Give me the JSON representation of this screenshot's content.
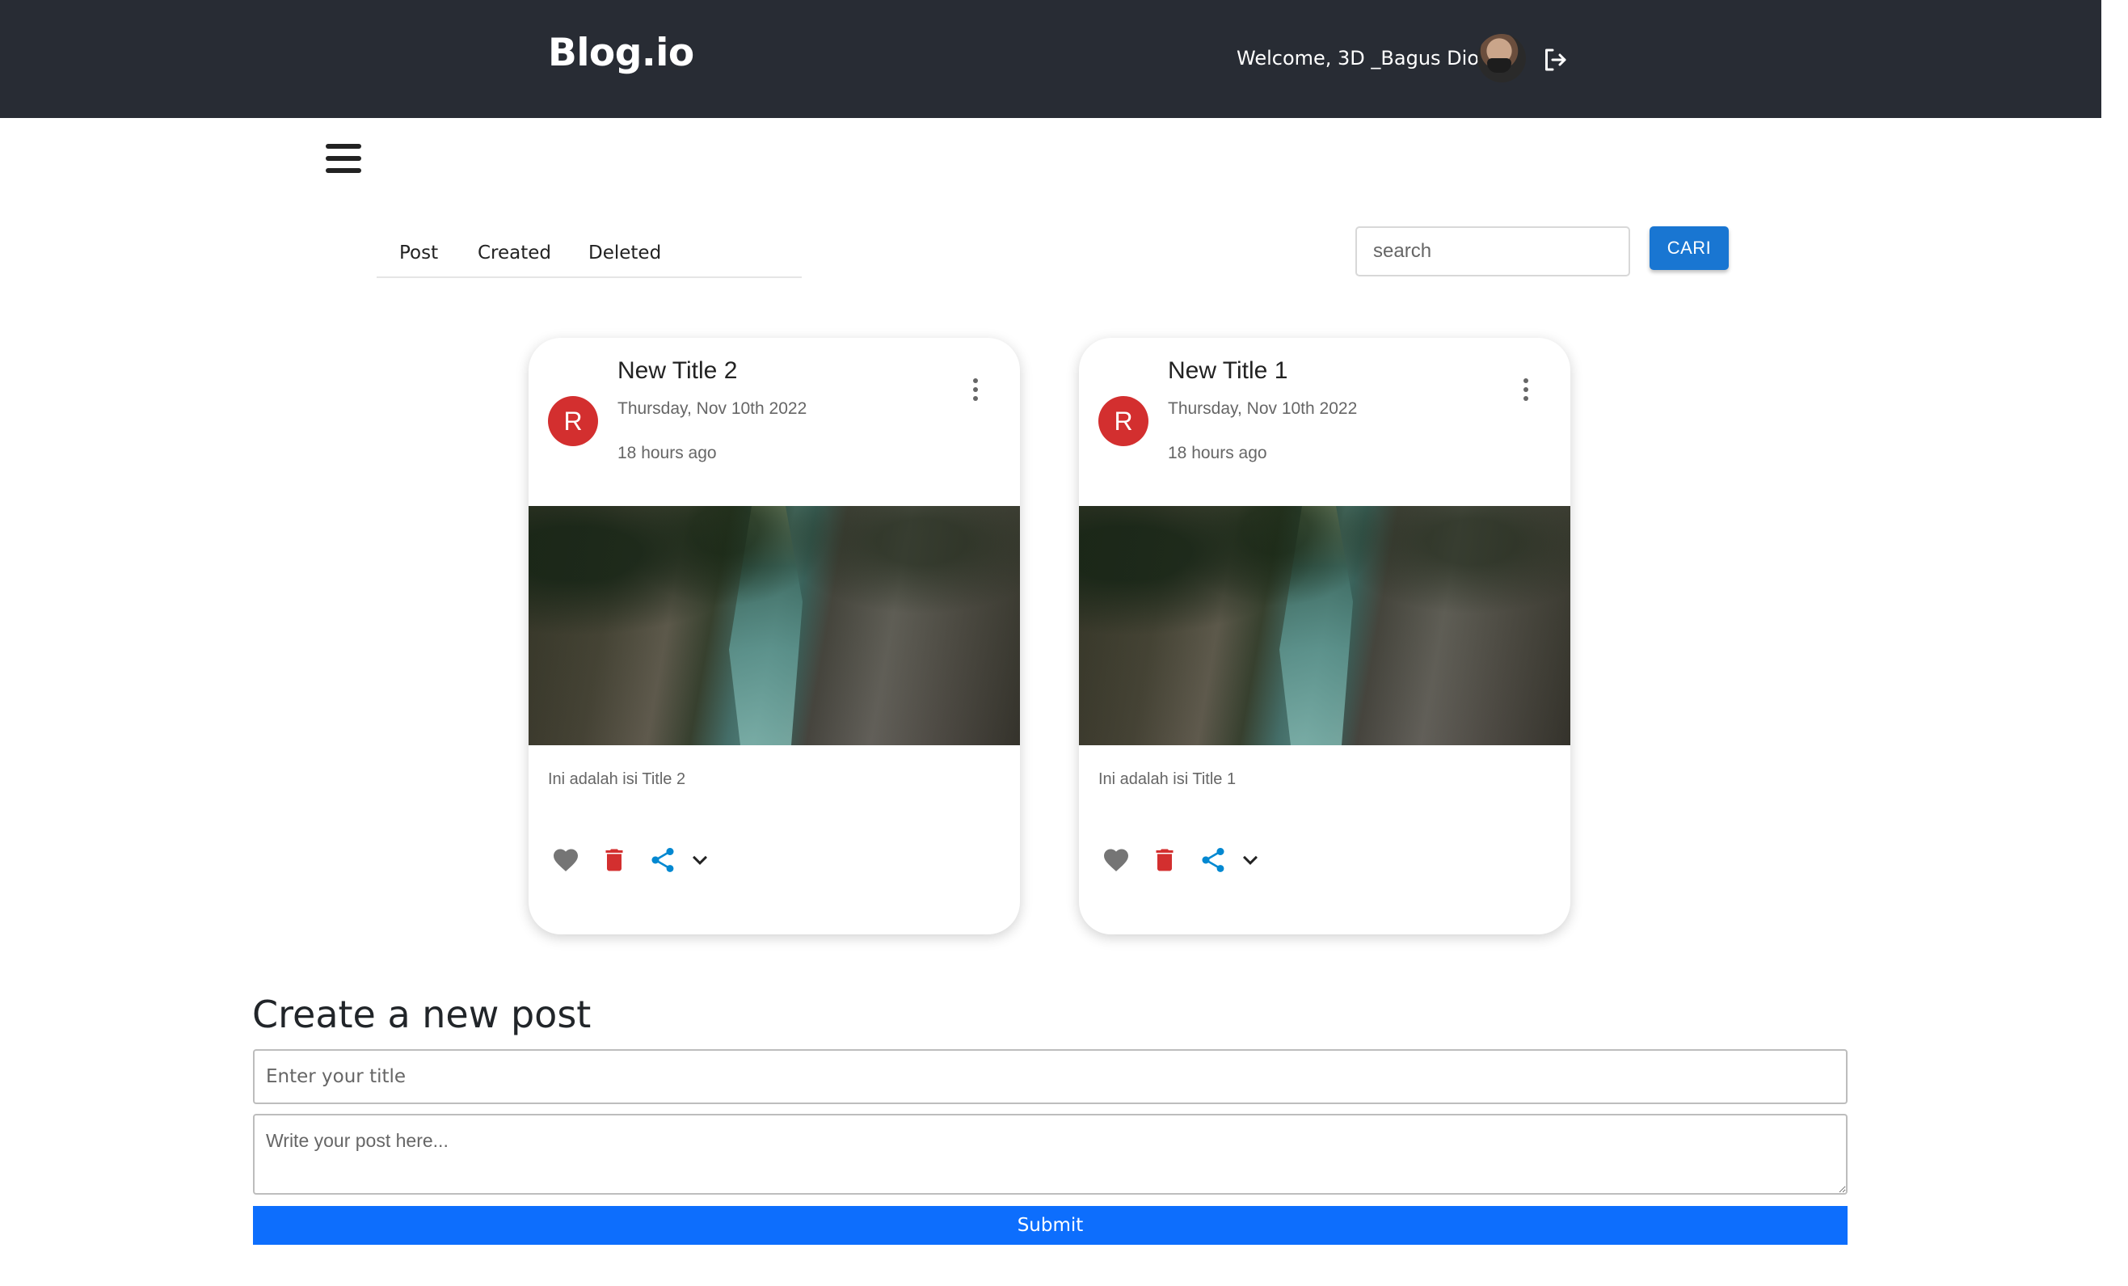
{
  "header": {
    "brand": "Blog.io",
    "welcome": "Welcome, 3D _Bagus Dio!"
  },
  "tabs": [
    {
      "label": "Post"
    },
    {
      "label": "Created"
    },
    {
      "label": "Deleted"
    }
  ],
  "search": {
    "placeholder": "search",
    "button_label": "CARI"
  },
  "posts": [
    {
      "avatar_letter": "R",
      "title": "New Title 2",
      "date": "Thursday, Nov 10th 2022",
      "relative_time": "18 hours ago",
      "body": "Ini adalah isi Title 2"
    },
    {
      "avatar_letter": "R",
      "title": "New Title 1",
      "date": "Thursday, Nov 10th 2022",
      "relative_time": "18 hours ago",
      "body": "Ini adalah isi Title 1"
    }
  ],
  "create_post": {
    "heading": "Create a new post",
    "title_placeholder": "Enter your title",
    "content_placeholder": "Write your post here...",
    "submit_label": "Submit"
  },
  "colors": {
    "header_bg": "#282c34",
    "accent_blue": "#1976d2",
    "submit_blue": "#0d6efd",
    "avatar_red": "#d32f2f",
    "share_blue": "#0288d1"
  }
}
